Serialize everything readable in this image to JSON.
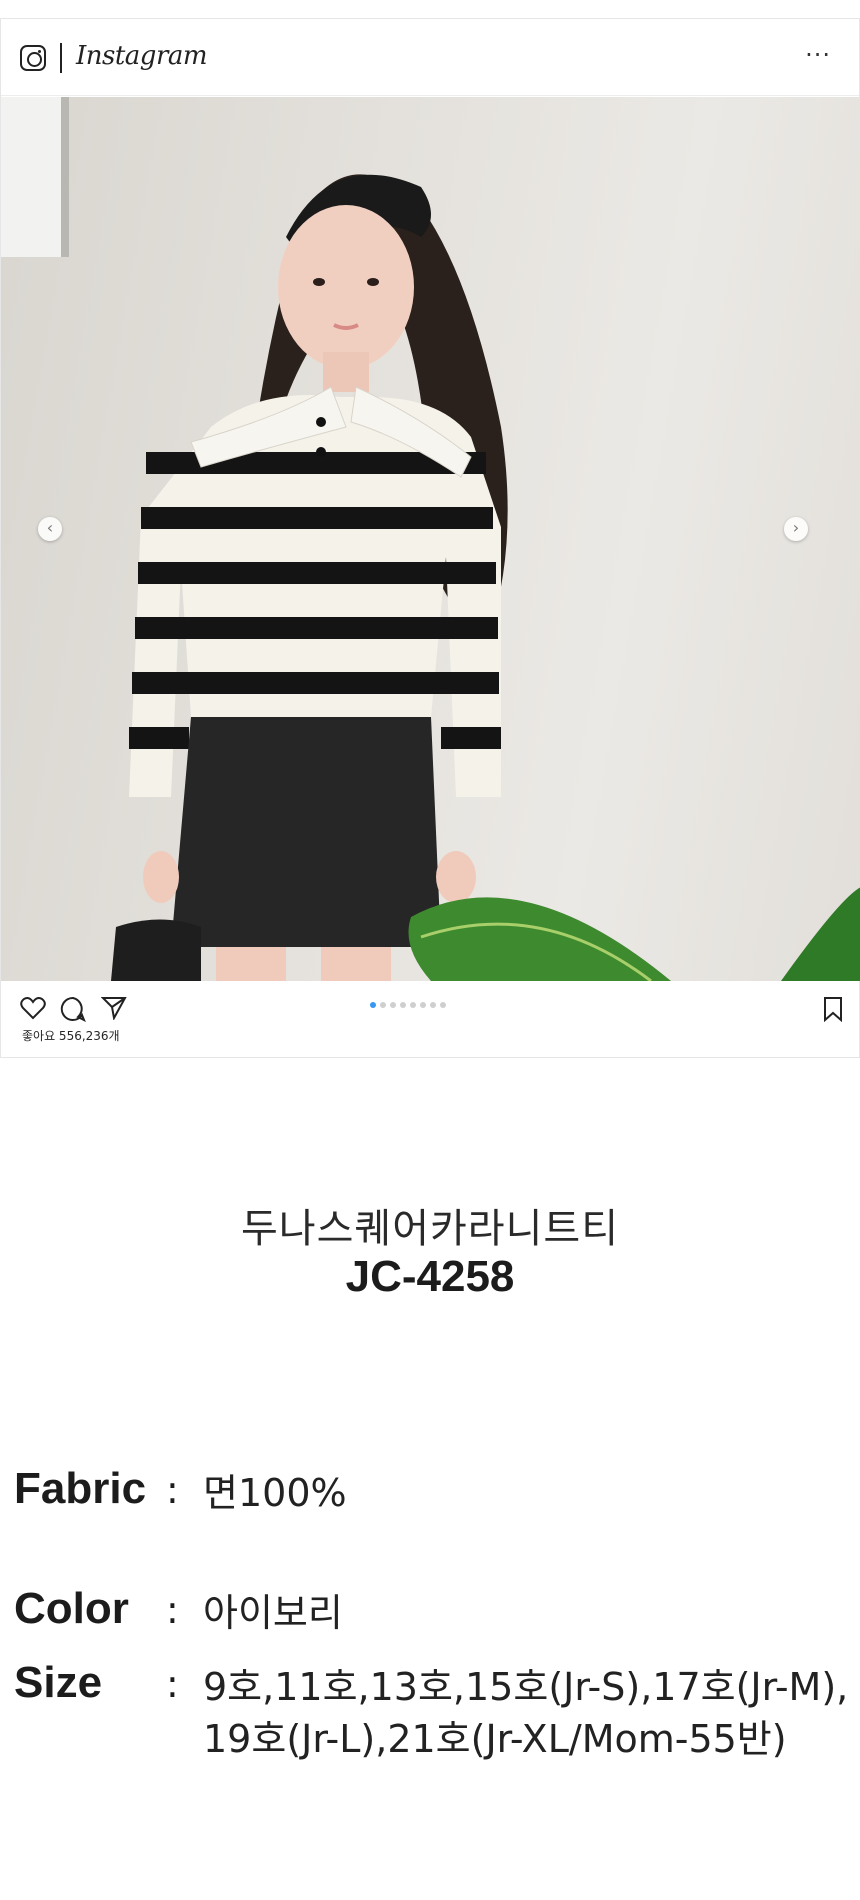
{
  "post": {
    "brand": "Instagram",
    "more_label": "···",
    "likes_text": "좋아요 556,236개",
    "carousel_dots": 8,
    "active_dot": 0
  },
  "product": {
    "name": "두나스퀘어카라니트티",
    "code": "JC-4258"
  },
  "specs": {
    "fabric": {
      "label": "Fabric",
      "colon": ":",
      "value": "면100%"
    },
    "color": {
      "label": "Color",
      "colon": ":",
      "value": "아이보리"
    },
    "size": {
      "label": "Size",
      "colon": ":",
      "value_line1": "9호,11호,13호,15호(Jr-S),17호(Jr-M),",
      "value_line2": "19호(Jr-L),21호(Jr-XL/Mom-55반)"
    }
  },
  "icons": {
    "camera": "instagram-camera-icon",
    "like": "heart-icon",
    "comment": "comment-icon",
    "share": "send-icon",
    "save": "bookmark-icon",
    "prev": "chevron-left-icon",
    "next": "chevron-right-icon"
  },
  "colors": {
    "active_dot": "#3897f0",
    "inactive_dot": "#cfcfcf",
    "text": "#1c1c1c"
  }
}
